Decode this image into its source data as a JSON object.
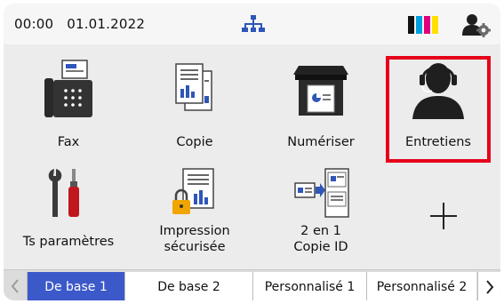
{
  "status": {
    "time": "00:00",
    "date": "01.01.2022",
    "network_icon": "network-icon",
    "ink_icon": "ink-levels-icon",
    "ink_colors": [
      "#111111",
      "#00a0e0",
      "#e0007a",
      "#ffe000"
    ],
    "admin_icon": "admin-settings-icon"
  },
  "apps": [
    {
      "label": "Fax",
      "icon": "fax-icon"
    },
    {
      "label": "Copie",
      "icon": "copy-icon"
    },
    {
      "label": "Numériser",
      "icon": "scan-icon"
    },
    {
      "label": "Entretiens",
      "icon": "support-headset-icon"
    },
    {
      "label": "Ts paramètres",
      "icon": "tools-icon"
    },
    {
      "label_line1": "Impression",
      "label_line2": "sécurisée",
      "icon": "secure-print-icon"
    },
    {
      "label_line1": "2 en 1",
      "label_line2": "Copie ID",
      "icon": "id-copy-icon"
    },
    {
      "icon": "add-shortcut-icon"
    }
  ],
  "tabs": [
    {
      "label": "De base 1",
      "active": true
    },
    {
      "label": "De base 2",
      "active": false
    },
    {
      "label": "Personnalisé 1",
      "active": false
    },
    {
      "label": "Personnalisé 2",
      "active": false
    }
  ],
  "colors": {
    "highlight": "#e6001a",
    "active_tab": "#3c59c9",
    "icon_dark": "#1f1f1f",
    "icon_blue": "#2f56b8"
  }
}
